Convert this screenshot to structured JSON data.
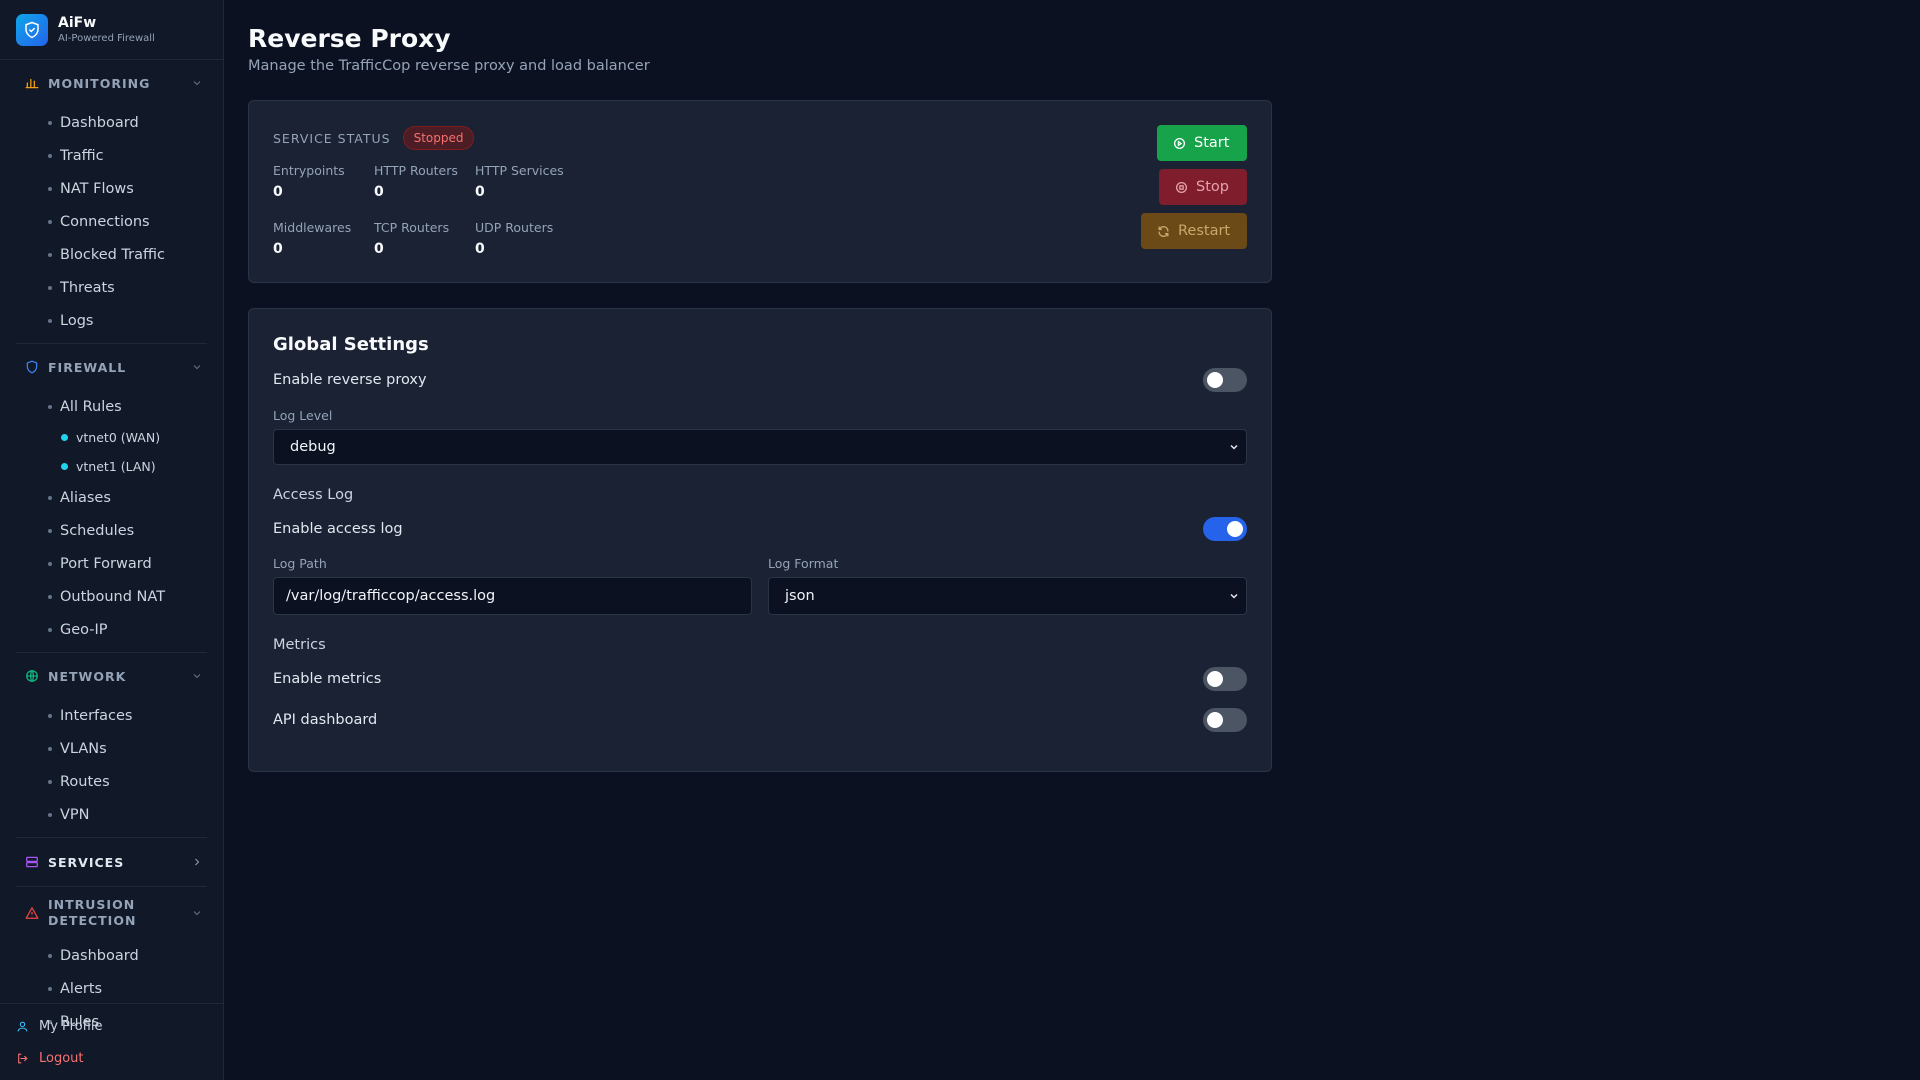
{
  "brand": {
    "name": "AiFw",
    "subtitle": "AI-Powered Firewall"
  },
  "sidebar": {
    "monitoring": {
      "title": "MONITORING",
      "items": [
        "Dashboard",
        "Traffic",
        "NAT Flows",
        "Connections",
        "Blocked Traffic",
        "Threats",
        "Logs"
      ]
    },
    "firewall": {
      "title": "FIREWALL",
      "all_rules": "All Rules",
      "interfaces": [
        "vtnet0 (WAN)",
        "vtnet1 (LAN)"
      ],
      "items": [
        "Aliases",
        "Schedules",
        "Port Forward",
        "Outbound NAT",
        "Geo-IP"
      ]
    },
    "network": {
      "title": "NETWORK",
      "items": [
        "Interfaces",
        "VLANs",
        "Routes",
        "VPN"
      ]
    },
    "services": {
      "title": "SERVICES"
    },
    "intrusion": {
      "title_line1": "INTRUSION",
      "title_line2": "DETECTION",
      "items": [
        "Dashboard",
        "Alerts",
        "Rules"
      ]
    },
    "footer": {
      "profile": "My Profile",
      "logout": "Logout"
    }
  },
  "page": {
    "title": "Reverse Proxy",
    "subtitle": "Manage the TrafficCop reverse proxy and load balancer"
  },
  "status": {
    "label": "SERVICE STATUS",
    "badge": "Stopped",
    "stats": [
      {
        "label": "Entrypoints",
        "value": "0"
      },
      {
        "label": "HTTP Routers",
        "value": "0"
      },
      {
        "label": "HTTP Services",
        "value": "0"
      },
      {
        "label": "Middlewares",
        "value": "0"
      },
      {
        "label": "TCP Routers",
        "value": "0"
      },
      {
        "label": "UDP Routers",
        "value": "0"
      }
    ],
    "buttons": {
      "start": "Start",
      "stop": "Stop",
      "restart": "Restart"
    }
  },
  "settings": {
    "title": "Global Settings",
    "enable_proxy": {
      "label": "Enable reverse proxy",
      "on": false
    },
    "log_level": {
      "label": "Log Level",
      "value": "debug"
    },
    "access_log": {
      "group": "Access Log",
      "enable_label": "Enable access log",
      "enabled": true,
      "path_label": "Log Path",
      "path_value": "/var/log/trafficcop/access.log",
      "format_label": "Log Format",
      "format_value": "json"
    },
    "metrics": {
      "group": "Metrics",
      "enable_label": "Enable metrics",
      "enabled": false,
      "dashboard_label": "API dashboard",
      "dashboard_enabled": false
    }
  },
  "colors": {
    "accent": "#2563eb",
    "start": "#16a34a",
    "stop": "#7f1d2d",
    "restart": "#6b4a17",
    "stopped_badge": "#f87171"
  }
}
